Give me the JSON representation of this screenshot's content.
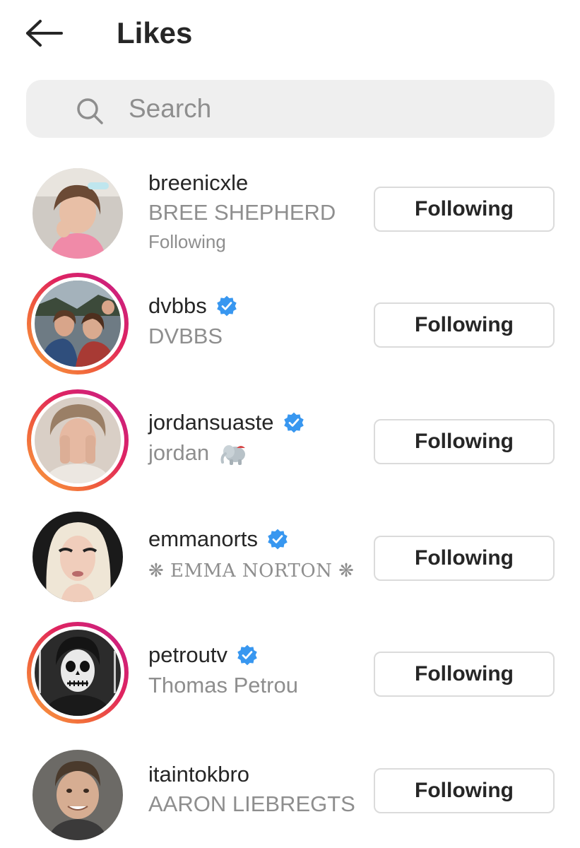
{
  "header": {
    "back_icon": "arrow-left-icon",
    "title": "Likes"
  },
  "search": {
    "icon": "search-icon",
    "placeholder": "Search",
    "value": ""
  },
  "users": [
    {
      "username": "breenicxle",
      "full_name": "BREE SHEPHERD",
      "subtext": "Following",
      "verified": false,
      "story_ring": false,
      "button": "Following"
    },
    {
      "username": "dvbbs",
      "full_name": "DVBBS",
      "subtext": "",
      "verified": true,
      "story_ring": true,
      "button": "Following"
    },
    {
      "username": "jordansuaste",
      "full_name": "jordan",
      "full_name_emoji": "elephant-emoji",
      "subtext": "",
      "verified": true,
      "story_ring": true,
      "button": "Following"
    },
    {
      "username": "emmanorts",
      "full_name": "❋ EMMA NORTON ❋",
      "subtext": "",
      "verified": true,
      "story_ring": false,
      "button": "Following"
    },
    {
      "username": "petroutv",
      "full_name": "Thomas Petrou",
      "subtext": "",
      "verified": true,
      "story_ring": true,
      "button": "Following"
    },
    {
      "username": "itaintokbro",
      "full_name": "AARON LIEBREGTS",
      "subtext": "",
      "verified": false,
      "story_ring": false,
      "button": "Following"
    }
  ],
  "colors": {
    "text_primary": "#262626",
    "text_secondary": "#8e8e8e",
    "verified_blue": "#3897f0",
    "search_bg": "#efefef",
    "button_border": "#dbdbdb"
  }
}
